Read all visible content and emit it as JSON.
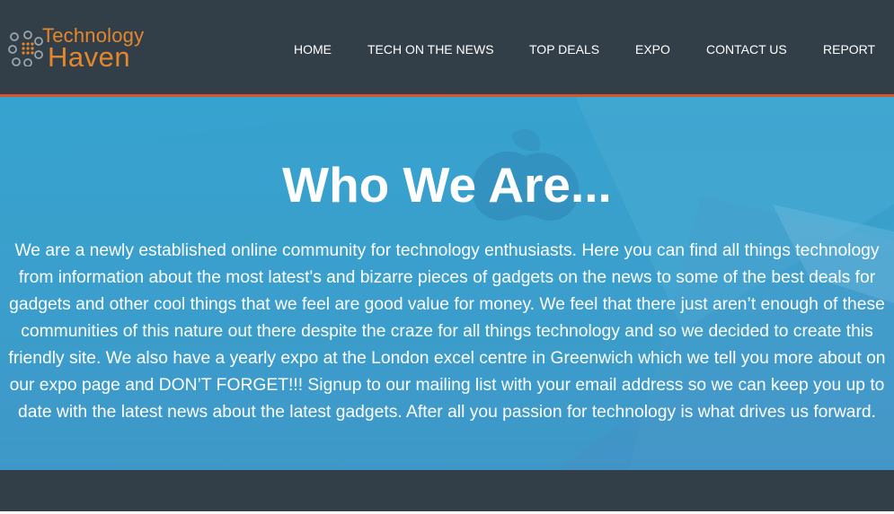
{
  "brand": {
    "line1": "Technology",
    "line2": "Haven",
    "color": "#e4872c"
  },
  "nav": {
    "items": [
      {
        "label": "HOME"
      },
      {
        "label": "TECH ON THE NEWS"
      },
      {
        "label": "TOP DEALS"
      },
      {
        "label": "EXPO"
      },
      {
        "label": "CONTACT US"
      },
      {
        "label": "REPORT"
      }
    ]
  },
  "hero": {
    "title": "Who We Are...",
    "body": "We are a newly established online community for technology enthusiasts. Here you can find all things technology from information about the most latest's and bizarre pieces of gadgets on the news to some of the best deals for gadgets and other cool things that we feel are good value for money. We feel that there just aren’t enough of these communities of this nature out there despite the craze for all things technology and so we decided to create this friendly site. We also have a yearly expo at the London excel centre in Greenwich which we tell you more about on our expo page and DON’T FORGET!!! Signup to our mailing list with your email address so we can keep you up to date with the latest news about the latest gadgets. After all you passion for technology is what drives us forward."
  },
  "colors": {
    "header_bg": "#333f48",
    "accent_border": "#d9542b",
    "hero_bg": "#3b9fcd",
    "text": "#ffffff"
  }
}
